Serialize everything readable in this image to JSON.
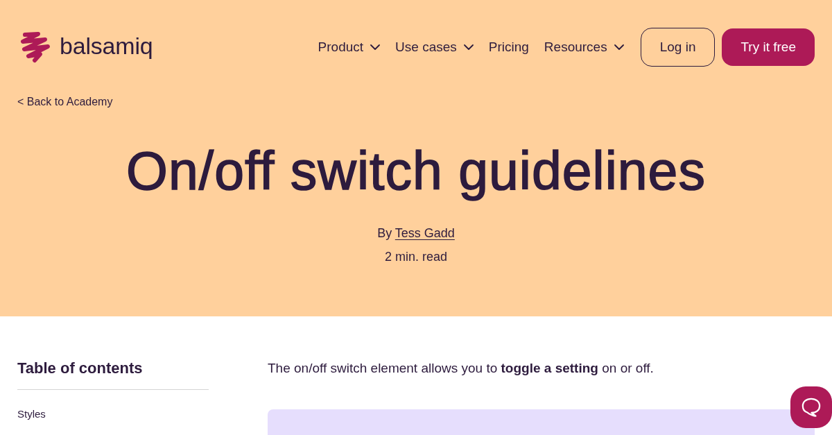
{
  "header": {
    "logo": {
      "wordmark": "balsamiq"
    },
    "nav": [
      {
        "label": "Product",
        "has_menu": true
      },
      {
        "label": "Use cases",
        "has_menu": true
      },
      {
        "label": "Pricing",
        "has_menu": false
      },
      {
        "label": "Resources",
        "has_menu": true
      }
    ],
    "buttons": [
      {
        "label": "Log in",
        "kind": "outline"
      },
      {
        "label": "Try it free",
        "kind": "primary"
      }
    ]
  },
  "back_link": "< Back to Academy",
  "hero": {
    "title": "On/off switch guidelines",
    "byline": {
      "prefix": "By",
      "author": "Tess Gadd"
    },
    "read_time": "2 min. read"
  },
  "toc": {
    "heading": "Table of contents",
    "items": [
      "Styles"
    ]
  },
  "article": {
    "intro": "The on/off switch element allows you to **toggle a setting** on or off."
  }
}
